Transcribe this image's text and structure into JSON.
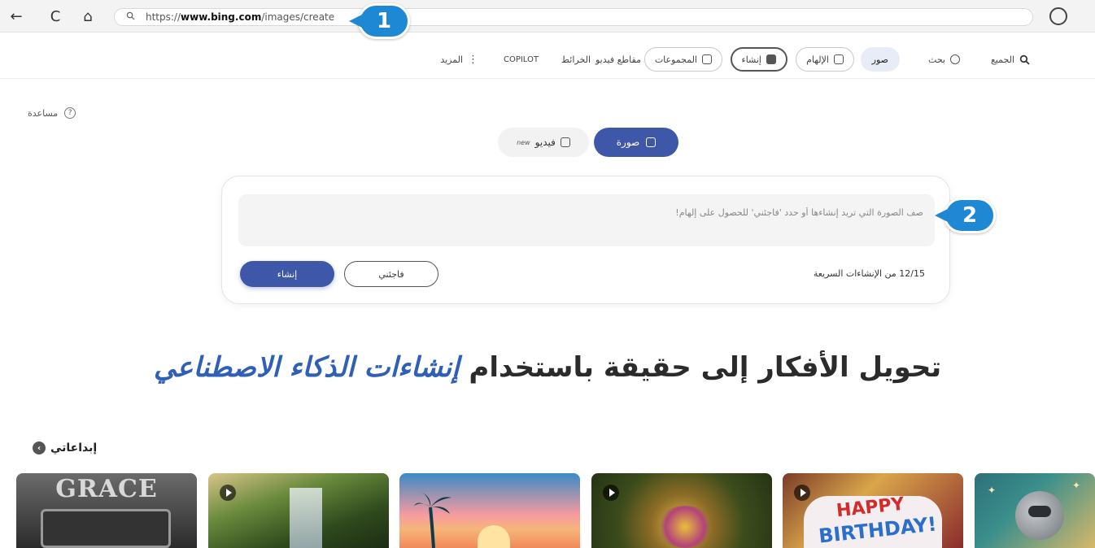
{
  "browser": {
    "url_prefix": "https://",
    "url_domain": "www.bing.com",
    "url_path": "/images/create",
    "nav_back": "←",
    "nav_refresh": "C",
    "nav_home": "⌂"
  },
  "callouts": {
    "one": "1",
    "two": "2"
  },
  "nav": {
    "all": "الجميع",
    "search": "بحث",
    "images": "صور",
    "inspiration": "الإلهام",
    "create": "إنشاء",
    "collections": "المجموعات",
    "videos": "مقاطع فيديو",
    "maps": "الخرائط",
    "copilot": "COPILOT",
    "more": "المزيد"
  },
  "help": "مساعدة",
  "modes": {
    "image": "صورة",
    "video": "فيديو",
    "video_badge": "new"
  },
  "prompt": {
    "placeholder": "صف الصورة التي تريد إنشاءها أو حدد 'فاجئني' للحصول على إلهام!",
    "counter": "12/15 من الإنشاءات السريعة",
    "surprise_label": "فاجئني",
    "create_label": "إنشاء"
  },
  "headline": {
    "plain": "تحويل الأفكار إلى حقيقة باستخدام ",
    "accent": "إنشاءات الذكاء الاصطناعي"
  },
  "creations": {
    "title": "إبداعاتي",
    "thumb1_text": "GRACE",
    "thumb5_line1": "HAPPY",
    "thumb5_line2": "BIRTHDAY!"
  }
}
